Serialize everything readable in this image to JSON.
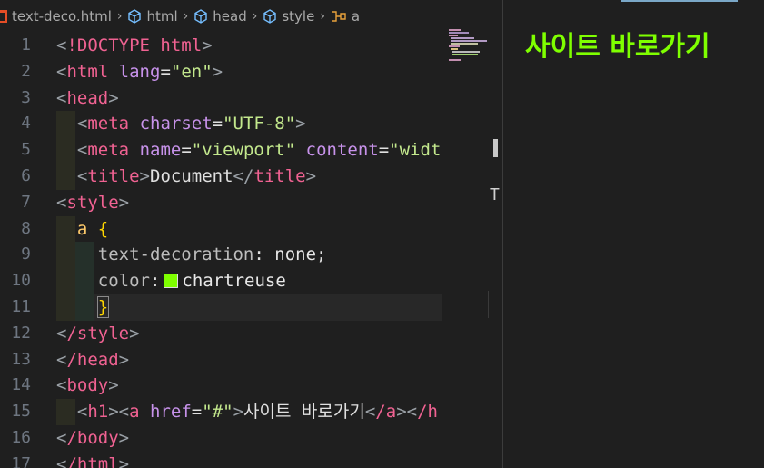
{
  "breadcrumb": {
    "file": "text-deco.html",
    "items": [
      "html",
      "head",
      "style",
      "a"
    ]
  },
  "line_numbers": [
    "1",
    "2",
    "3",
    "4",
    "5",
    "6",
    "7",
    "8",
    "9",
    "10",
    "11",
    "12",
    "13",
    "14",
    "15",
    "16",
    "17"
  ],
  "code": {
    "l1": {
      "open": "<",
      "tag": "!DOCTYPE html",
      "close": ">"
    },
    "l2": {
      "tag": "html",
      "attr": "lang",
      "val": "\"en\""
    },
    "l3": {
      "tag": "head"
    },
    "l4": {
      "tag": "meta",
      "attr": "charset",
      "val": "\"UTF-8\""
    },
    "l5": {
      "tag": "meta",
      "attr1": "name",
      "val1": "\"viewport\"",
      "attr2": "content",
      "val2": "\"width=d"
    },
    "l6": {
      "tag": "title",
      "text": "Document",
      "end": "title"
    },
    "l7": {
      "tag": "style"
    },
    "l8": {
      "sel": "a",
      "brace": "{"
    },
    "l9": {
      "prop": "text-decoration",
      "val": "none"
    },
    "l10": {
      "prop": "color",
      "val": "chartreuse"
    },
    "l11": {
      "brace": "}"
    },
    "l12": {
      "tag": "/style"
    },
    "l13": {
      "tag": "/head"
    },
    "l14": {
      "tag": "body"
    },
    "l15": {
      "tag": "h1",
      "tag2": "a",
      "attr": "href",
      "val": "\"#\"",
      "text": "사이트 바로가기",
      "end": "/a",
      "end2": "/h"
    },
    "l16": {
      "tag": "/body"
    },
    "l17": {
      "tag": "/html"
    }
  },
  "colors": {
    "swatch": "#7fff00",
    "link": "#7fff00"
  },
  "preview": {
    "link_text": "사이트 바로가기"
  }
}
